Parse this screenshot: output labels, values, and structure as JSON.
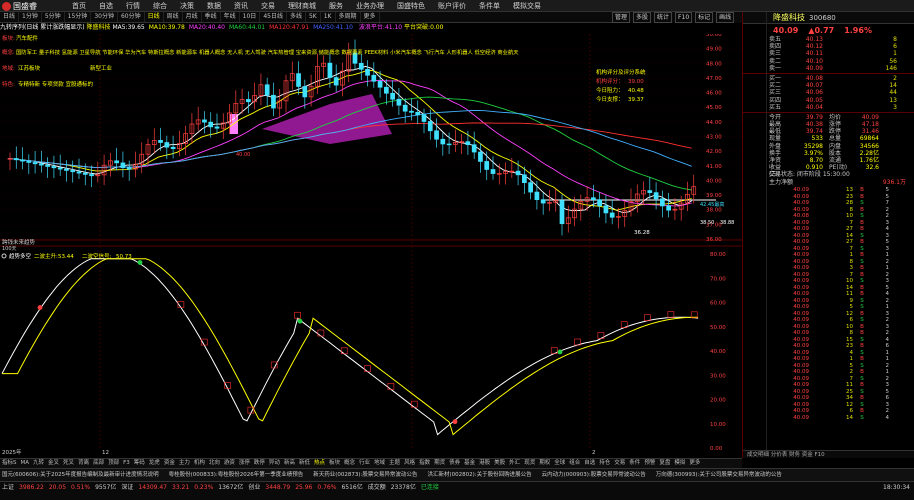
{
  "app": {
    "name": "国盛睿",
    "menu": [
      "首页",
      "自选",
      "行情",
      "综合",
      "决策",
      "数据",
      "资讯",
      "交易",
      "理财商城",
      "服务",
      "业务办理",
      "国盛特色",
      "账户评价",
      "条件单",
      "模拟交易"
    ]
  },
  "tabs": [
    "日线",
    "1分钟",
    "5分钟",
    "15分钟",
    "30分钟",
    "60分钟",
    "日线",
    "周线",
    "月线",
    "季线",
    "年线",
    "10日",
    "45日线",
    "多线",
    "5K",
    "1K",
    "多周期",
    "更多"
  ],
  "active_tab": 6,
  "tools": [
    "管理",
    "多股",
    "统计",
    "F10",
    "标记",
    "画线"
  ],
  "info": {
    "indicator": "九转序列(日线 累计涨跌幅显示)",
    "stock": "降盛科技",
    "ma_labels": [
      {
        "t": "MA5:39.65",
        "c": "#ffffff"
      },
      {
        "t": "MA10:39.78",
        "c": "#ffff00"
      },
      {
        "t": "MA20:40.40",
        "c": "#ff40ff"
      },
      {
        "t": "MA60:44.01",
        "c": "#20d040"
      },
      {
        "t": "MA120:47.91",
        "c": "#ff3030"
      },
      {
        "t": "MA250:41.10",
        "c": "#4060ff"
      }
    ],
    "extra": "波浪平台:41.10",
    "extra2": "平台突破:0.00"
  },
  "annotations": {
    "sector_title": "汽车配件",
    "concepts": "国防军工 量子科技 氢能源 卫星导航 节能环保 华为汽车 特斯拉概念 新能源车 机器人概念 无人机 无人驾驶 汽车热管理 宝来资源 储能概念 数据要素 PEEK材料 小米汽车概念 飞行汽车 人形机器人 低空经济 商业航天",
    "sector": "江苏板块",
    "sector_tag": "新型工业",
    "special": "专精特新 专项贷款 宜股通标的",
    "rating_title": "机构评分及评分系统",
    "rating1_label": "机构评分：",
    "rating1": "39.00",
    "rating2_label": "今日阻力：",
    "rating2": "40.48",
    "rating3_label": "今日支撑：",
    "rating3": "39.37",
    "low_price": "36.28",
    "right_price": "38.50",
    "right_price2": "38.88",
    "high_label": "42.45最高",
    "mid_label": "40.00",
    "date_left": "2025年",
    "date_mid": "12",
    "date_right": "2",
    "osc_title": "趋势多空",
    "osc_v1_label": "二波主升:",
    "osc_v1": "53.44",
    "osc_v2_label": "二波空信号:",
    "osc_v2": "50.73",
    "vol_label": "跨钱未来趋势",
    "vol_sub": "100天"
  },
  "yaxis_top": [
    "50.00",
    "49.00",
    "48.00",
    "47.00",
    "46.00",
    "45.00",
    "44.00",
    "43.00",
    "42.00",
    "41.00",
    "40.00",
    "39.00",
    "38.00",
    "37.00",
    "36.00"
  ],
  "yaxis_bottom": [
    "80.00",
    "70.00",
    "60.00",
    "50.00",
    "40.00",
    "30.00",
    "20.00",
    "10.00",
    "0.00"
  ],
  "quote": {
    "name": "降盛科技",
    "code": "300680",
    "price": "40.09",
    "change": "▲0.77",
    "pct": "1.96%",
    "asks": [
      {
        "l": "卖五",
        "p": "40.13",
        "v": "8"
      },
      {
        "l": "卖四",
        "p": "40.12",
        "v": "6"
      },
      {
        "l": "卖三",
        "p": "40.11",
        "v": "1"
      },
      {
        "l": "卖二",
        "p": "40.10",
        "v": "56"
      },
      {
        "l": "卖一",
        "p": "40.09",
        "v": "146"
      }
    ],
    "bids": [
      {
        "l": "买一",
        "p": "40.08",
        "v": "2"
      },
      {
        "l": "买二",
        "p": "40.07",
        "v": "14"
      },
      {
        "l": "买三",
        "p": "40.06",
        "v": "44"
      },
      {
        "l": "买四",
        "p": "40.05",
        "v": "13"
      },
      {
        "l": "买五",
        "p": "40.04",
        "v": "3"
      }
    ],
    "stats": [
      {
        "a": "今开",
        "b": "39.79",
        "c": "均价",
        "d": "40.09"
      },
      {
        "a": "最高",
        "b": "40.38",
        "c": "涨停",
        "d": "47.18"
      },
      {
        "a": "最低",
        "b": "39.74",
        "c": "跌停",
        "d": "31.46"
      },
      {
        "a": "现量",
        "b": "533",
        "c": "总量",
        "d": "69864"
      },
      {
        "a": "外盘",
        "b": "35298",
        "c": "内盘",
        "d": "34566"
      },
      {
        "a": "换手",
        "b": "3.97%",
        "c": "股本",
        "d": "2.28亿"
      },
      {
        "a": "净资",
        "b": "8.70",
        "c": "流通",
        "d": "1.76亿"
      },
      {
        "a": "收益(三)",
        "b": "0.910",
        "c": "PE(动)",
        "d": "32.6"
      }
    ],
    "status": "交易状态: 闭市阶段 15:30:00",
    "mainflow_label": "主力净额",
    "mainflow_value": "936.1万",
    "ticks": [
      {
        "p": "40.09",
        "v": "13",
        "s": "B",
        "n": "5"
      },
      {
        "p": "40.09",
        "v": "23",
        "s": "B",
        "n": "5"
      },
      {
        "p": "40.09",
        "v": "28",
        "s": "S",
        "n": "7"
      },
      {
        "p": "40.09",
        "v": "8",
        "s": "B",
        "n": "2"
      },
      {
        "p": "40.08",
        "v": "10",
        "s": "S",
        "n": "2"
      },
      {
        "p": "40.09",
        "v": "7",
        "s": "B",
        "n": "3"
      },
      {
        "p": "40.09",
        "v": "27",
        "s": "B",
        "n": "4"
      },
      {
        "p": "40.09",
        "v": "14",
        "s": "S",
        "n": "3"
      },
      {
        "p": "40.09",
        "v": "27",
        "s": "B",
        "n": "5"
      },
      {
        "p": "40.09",
        "v": "7",
        "s": "S",
        "n": "3"
      },
      {
        "p": "40.09",
        "v": "1",
        "s": "B",
        "n": "1"
      },
      {
        "p": "40.09",
        "v": "8",
        "s": "S",
        "n": "2"
      },
      {
        "p": "40.09",
        "v": "3",
        "s": "B",
        "n": "1"
      },
      {
        "p": "40.09",
        "v": "7",
        "s": "B",
        "n": "2"
      },
      {
        "p": "40.09",
        "v": "10",
        "s": "S",
        "n": "3"
      },
      {
        "p": "40.09",
        "v": "14",
        "s": "B",
        "n": "5"
      },
      {
        "p": "40.09",
        "v": "11",
        "s": "B",
        "n": "4"
      },
      {
        "p": "40.09",
        "v": "9",
        "s": "S",
        "n": "2"
      },
      {
        "p": "40.09",
        "v": "5",
        "s": "S",
        "n": "1"
      },
      {
        "p": "40.09",
        "v": "12",
        "s": "B",
        "n": "3"
      },
      {
        "p": "40.09",
        "v": "6",
        "s": "S",
        "n": "2"
      },
      {
        "p": "40.09",
        "v": "10",
        "s": "B",
        "n": "3"
      },
      {
        "p": "40.09",
        "v": "8",
        "s": "B",
        "n": "2"
      },
      {
        "p": "40.09",
        "v": "15",
        "s": "S",
        "n": "4"
      },
      {
        "p": "40.09",
        "v": "23",
        "s": "B",
        "n": "6"
      },
      {
        "p": "40.09",
        "v": "4",
        "s": "S",
        "n": "1"
      },
      {
        "p": "40.09",
        "v": "1",
        "s": "B",
        "n": "1"
      },
      {
        "p": "40.09",
        "v": "5",
        "s": "S",
        "n": "2"
      },
      {
        "p": "40.09",
        "v": "2",
        "s": "B",
        "n": "1"
      },
      {
        "p": "40.09",
        "v": "7",
        "s": "S",
        "n": "2"
      },
      {
        "p": "40.09",
        "v": "11",
        "s": "B",
        "n": "3"
      },
      {
        "p": "40.09",
        "v": "25",
        "s": "S",
        "n": "5"
      },
      {
        "p": "40.09",
        "v": "34",
        "s": "B",
        "n": "6"
      },
      {
        "p": "40.09",
        "v": "12",
        "s": "S",
        "n": "3"
      },
      {
        "p": "40.09",
        "v": "6",
        "s": "B",
        "n": "2"
      },
      {
        "p": "40.09",
        "v": "14",
        "s": "S",
        "n": "4"
      }
    ],
    "footer": "成交明细 分价表 财务 资金 F10"
  },
  "bottom_tabs": [
    "指标S",
    "MA",
    "九转",
    "金叉",
    "死叉",
    "背离",
    "底部",
    "顶部",
    "F3",
    "筹码",
    "龙虎",
    "资金",
    "主力",
    "机构",
    "北向",
    "游资",
    "涨停",
    "跌停",
    "异动",
    "新高",
    "新低",
    "热点",
    "板块",
    "概念",
    "行业",
    "地域",
    "主题",
    "风格",
    "指数",
    "期货",
    "债券",
    "基金",
    "港股",
    "美股",
    "外汇",
    "现货",
    "期权",
    "全球",
    "组合",
    "自选",
    "持仓",
    "交易",
    "条件",
    "预警",
    "复盘",
    "模拟",
    "更多"
  ],
  "bottom_active": 21,
  "news": [
    "国元(600606):关于2025年度报告编制及最新审计进度情况说明",
    "粤桂股份(000833):粤桂股份2026年第一季度业绩预告",
    "新天药业(002873):股票交易异常波动公告",
    "洪汇新材(002802):关于股份回购进展公告",
    "云内动力(000903):股票交易异常波动公告",
    "万向德(300993):关于公司股票交易异常波动的公告"
  ],
  "status": [
    {
      "t": "上证",
      "c": "#ccc"
    },
    {
      "t": "3986.22",
      "c": "#ff4040"
    },
    {
      "t": "20.05",
      "c": "#ff4040"
    },
    {
      "t": "0.51%",
      "c": "#ff4040"
    },
    {
      "t": "9557亿",
      "c": "#ccc"
    },
    {
      "t": "深证",
      "c": "#ccc"
    },
    {
      "t": "14309.47",
      "c": "#ff4040"
    },
    {
      "t": "33.21",
      "c": "#ff4040"
    },
    {
      "t": "0.23%",
      "c": "#ff4040"
    },
    {
      "t": "13672亿",
      "c": "#ccc"
    },
    {
      "t": "创业",
      "c": "#ccc"
    },
    {
      "t": "3448.79",
      "c": "#ff4040"
    },
    {
      "t": "25.96",
      "c": "#ff4040"
    },
    {
      "t": "0.76%",
      "c": "#ff4040"
    },
    {
      "t": "6516亿",
      "c": "#ccc"
    },
    {
      "t": "成交额",
      "c": "#ccc"
    },
    {
      "t": "23378亿",
      "c": "#ccc"
    },
    {
      "t": "已连接",
      "c": "#20d040"
    }
  ],
  "clock": "18:30:34"
}
